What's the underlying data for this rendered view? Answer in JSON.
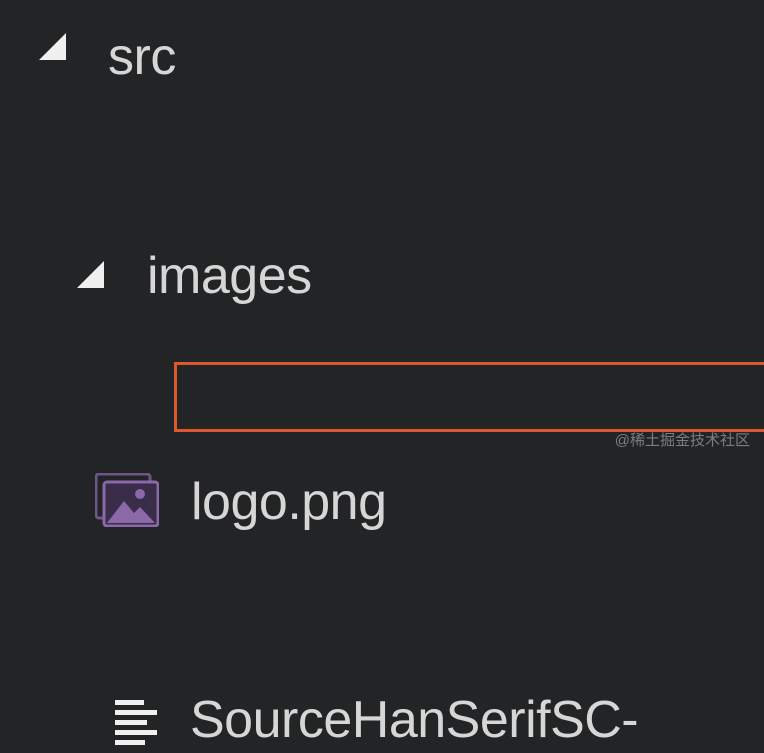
{
  "tree": {
    "items": [
      {
        "label": "src",
        "type": "folder",
        "expanded": true,
        "icon": "chevron-down-icon"
      },
      {
        "label": "images",
        "type": "folder",
        "expanded": true,
        "icon": "chevron-down-icon"
      },
      {
        "label": "logo.png",
        "type": "file",
        "icon": "image-file-icon"
      },
      {
        "label": "SourceHanSerifSC-",
        "type": "file",
        "icon": "text-file-icon",
        "highlighted": true
      }
    ]
  },
  "highlight": {
    "color": "#e0572e"
  },
  "watermark": {
    "text": "@稀土掘金技术社区"
  },
  "colors": {
    "background": "#222426",
    "text": "#d6d6d6",
    "image_icon": "#8b68a8"
  }
}
